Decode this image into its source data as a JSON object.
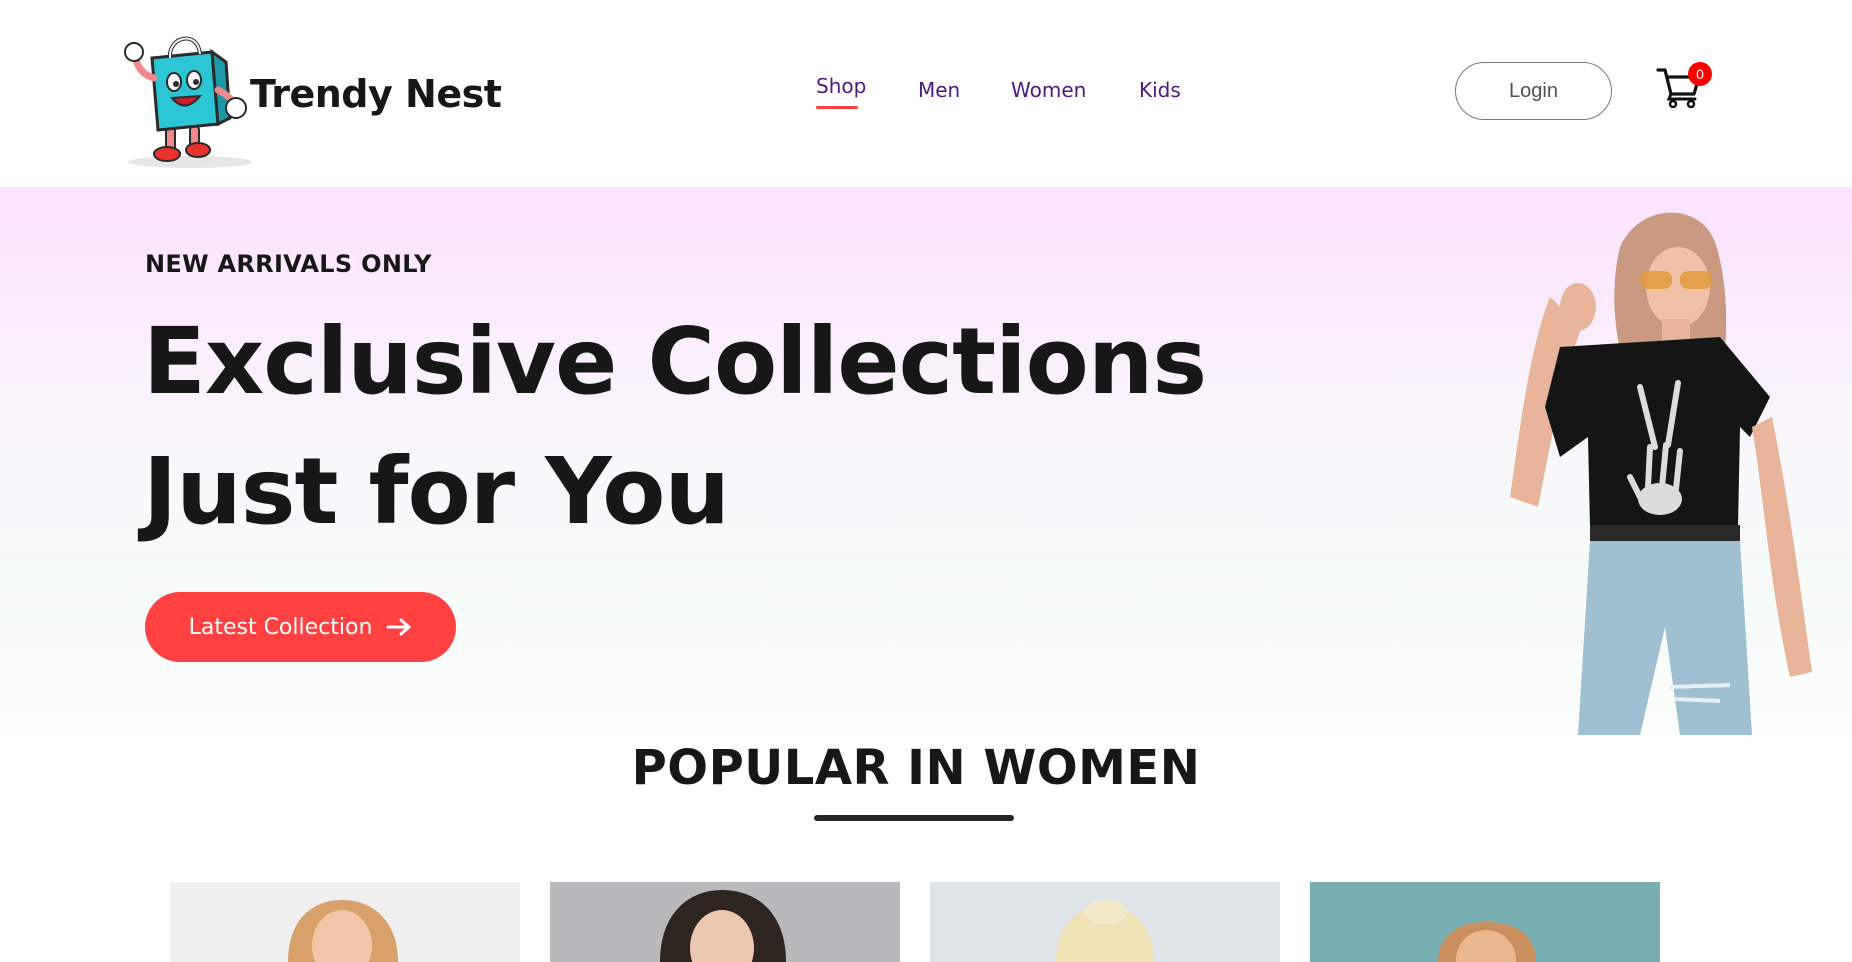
{
  "brand": {
    "name": "Trendy Nest",
    "accent_color": "#ff4141",
    "nav_color": "#4b1a7a"
  },
  "nav": {
    "items": [
      {
        "label": "Shop",
        "active": true
      },
      {
        "label": "Men",
        "active": false
      },
      {
        "label": "Women",
        "active": false
      },
      {
        "label": "Kids",
        "active": false
      }
    ]
  },
  "header": {
    "login_label": "Login",
    "cart_icon": "cart-icon",
    "cart_count": "0"
  },
  "hero": {
    "eyebrow": "NEW ARRIVALS ONLY",
    "title_line1": "Exclusive Collections",
    "title_line2": "Just for You",
    "cta_label": "Latest Collection",
    "cta_icon": "arrow-right-icon"
  },
  "popular": {
    "title": "POPULAR IN WOMEN",
    "cards": [
      {
        "bg": "#efefef"
      },
      {
        "bg": "#b9b9bb"
      },
      {
        "bg": "#dde3e6"
      },
      {
        "bg": "#78aeb3"
      }
    ]
  }
}
